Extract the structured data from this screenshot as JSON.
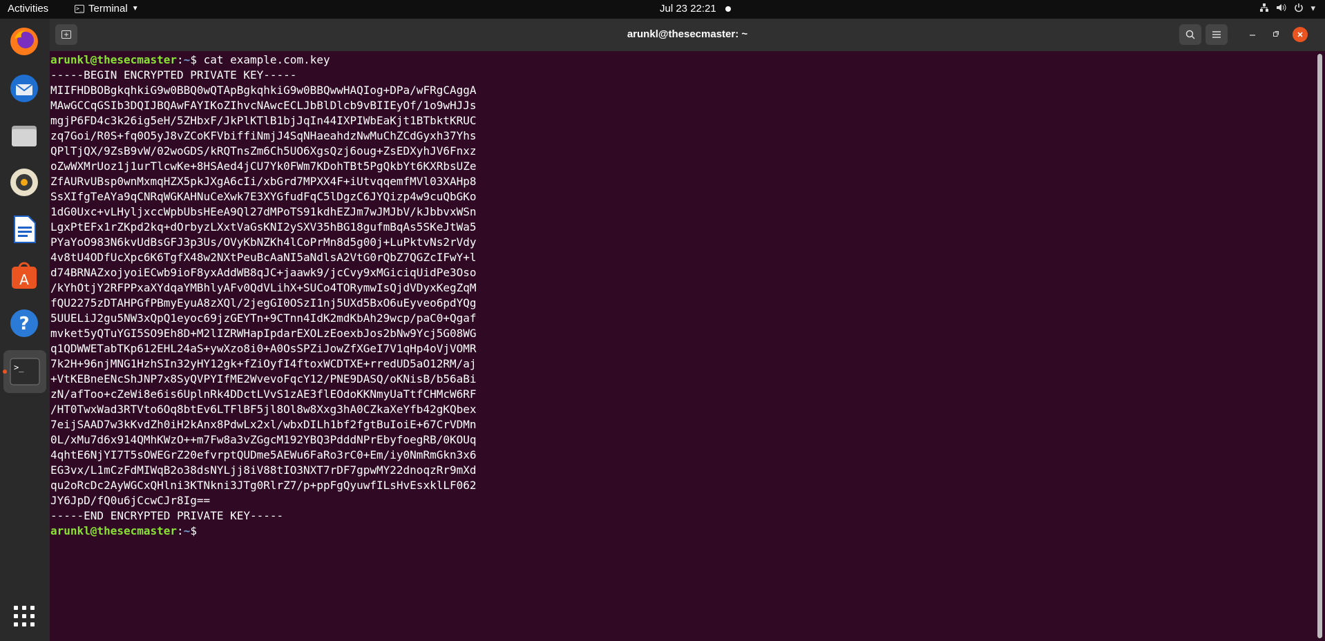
{
  "topbar": {
    "activities": "Activities",
    "app_name": "Terminal",
    "clock": "Jul 23  22:21"
  },
  "dock": {
    "apps": [
      "firefox-icon",
      "thunderbird-icon",
      "files-icon",
      "rhythmbox-icon",
      "libreoffice-writer-icon",
      "app-center-icon",
      "help-icon",
      "terminal-icon"
    ],
    "show_apps": "show-apps-icon"
  },
  "window": {
    "title": "arunkl@thesecmaster: ~"
  },
  "terminal": {
    "prompt_user": "arunkl@thesecmaster",
    "prompt_sep": ":",
    "prompt_path": "~",
    "prompt_end": "$ ",
    "command": "cat example.com.key",
    "output": [
      "-----BEGIN ENCRYPTED PRIVATE KEY-----",
      "MIIFHDBOBgkqhkiG9w0BBQ0wQTApBgkqhkiG9w0BBQwwHAQIog+DPa/wFRgCAggA",
      "MAwGCCqGSIb3DQIJBQAwFAYIKoZIhvcNAwcECLJbBlDlcb9vBIIEyOf/1o9wHJJs",
      "mgjP6FD4c3k26ig5eH/5ZHbxF/JkPlKTlB1bjJqIn44IXPIWbEaKjt1BTbktKRUC",
      "zq7Goi/R0S+fq0O5yJ8vZCoKFVbiffiNmjJ4SqNHaeahdzNwMuChZCdGyxh37Yhs",
      "QPlTjQX/9ZsB9vW/02woGDS/kRQTnsZm6Ch5UO6XgsQzj6oug+ZsEDXyhJV6Fnxz",
      "oZwWXMrUoz1j1urTlcwKe+8HSAed4jCU7Yk0FWm7KDohTBt5PgQkbYt6KXRbsUZe",
      "ZfAURvUBsp0wnMxmqHZX5pkJXgA6cIi/xbGrd7MPXX4F+iUtvqqemfMVl03XAHp8",
      "SsXIfgTeAYa9qCNRqWGKAHNuCeXwk7E3XYGfudFqC5lDgzC6JYQizp4w9cuQbGKo",
      "1dG0Uxc+vLHyljxccWpbUbsHEeA9Ql27dMPoTS91kdhEZJm7wJMJbV/kJbbvxWSn",
      "LgxPtEFx1rZKpd2kq+dOrbyzLXxtVaGsKNI2ySXV35hBG18gufmBqAs5SKeJtWa5",
      "PYaYoO983N6kvUdBsGFJ3p3Us/OVyKbNZKh4lCoPrMn8d5g00j+LuPktvNs2rVdy",
      "4v8tU4ODfUcXpc6K6TgfX48w2NXtPeuBcAaNI5aNdlsA2VtG0rQbZ7QGZcIFwY+l",
      "d74BRNAZxojyoiECwb9ioF8yxAddWB8qJC+jaawk9/jcCvy9xMGiciqUidPe3Oso",
      "/kYhOtjY2RFPPxaXYdqaYMBhlyAFv0QdVLihX+SUCo4TORymwIsQjdVDyxKegZqM",
      "fQU2275zDTAHPGfPBmyEyuA8zXQl/2jegGI0OSzI1nj5UXd5BxO6uEyveo6pdYQg",
      "5UUELiJ2gu5NW3xQpQ1eyoc69jzGEYTn+9CTnn4IdK2mdKbAh29wcp/paC0+Qgaf",
      "mvket5yQTuYGI5SO9Eh8D+M2lIZRWHapIpdarEXOLzEoexbJos2bNw9Ycj5G08WG",
      "q1QDWWETabTKp612EHL24aS+ywXzo8i0+A0OsSPZiJowZfXGeI7V1qHp4oVjVOMR",
      "7k2H+96njMNG1HzhSIn32yHY12gk+fZiOyfI4ftoxWCDTXE+rredUD5aO12RM/aj",
      "+VtKEBneENcShJNP7x8SyQVPYIfME2WvevoFqcY12/PNE9DASQ/oKNisB/b56aBi",
      "zN/afToo+cZeWi8e6is6UplnRk4DDctLVvS1zAE3flEOdoKKNmyUaTtfCHMcW6RF",
      "/HT0TwxWad3RTVto6Oq8btEv6LTFlBF5jl8Ol8w8Xxg3hA0CZkaXeYfb42gKQbex",
      "7eijSAAD7w3kKvdZh0iH2kAnx8PdwLx2xl/wbxDILh1bf2fgtBuIoiE+67CrVDMn",
      "0L/xMu7d6x914QMhKWzO++m7Fw8a3vZGgcM192YBQ3PdddNPrEbyfoegRB/0KOUq",
      "4qhtE6NjYI7T5sOWEGrZ20efvrptQUDme5AEWu6FaRo3rC0+Em/iy0NmRmGkn3x6",
      "EG3vx/L1mCzFdMIWqB2o38dsNYLjj8iV88tIO3NXT7rDF7gpwMY22dnoqzRr9mXd",
      "qu2oRcDc2AyWGCxQHlni3KTNkni3JTg0RlrZ7/p+ppFgQyuwfILsHvEsxklLF062",
      "JY6JpD/fQ0u6jCcwCJr8Ig==",
      "-----END ENCRYPTED PRIVATE KEY-----"
    ]
  }
}
